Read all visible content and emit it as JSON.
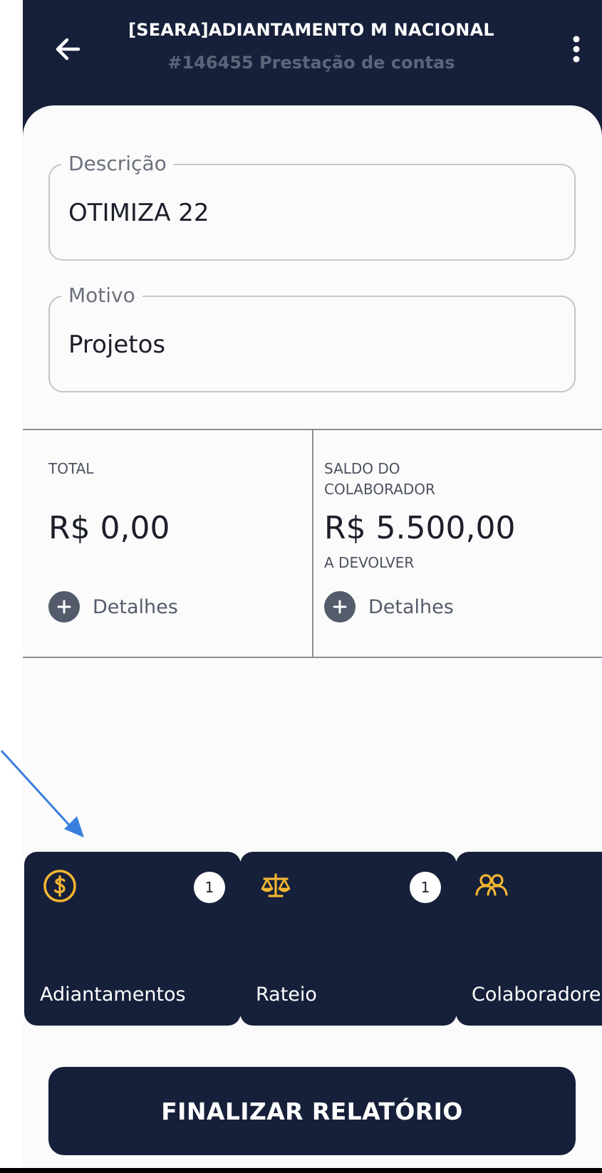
{
  "header": {
    "title": "[SEARA]ADIANTAMENTO M NACIONAL",
    "subtitle": "#146455 Prestação de contas",
    "back_icon": "arrow-left-icon",
    "menu_icon": "more-vertical-icon"
  },
  "form": {
    "description": {
      "label": "Descrição",
      "value": "OTIMIZA 22"
    },
    "reason": {
      "label": "Motivo",
      "value": "Projetos"
    }
  },
  "summary": {
    "total": {
      "label": "TOTAL",
      "value": "R$ 0,00",
      "details_label": "Detalhes"
    },
    "balance": {
      "label": "SALDO DO COLABORADOR",
      "value": "R$ 5.500,00",
      "sub_label": "A DEVOLVER",
      "details_label": "Detalhes"
    }
  },
  "cards": [
    {
      "label": "Adiantamentos",
      "badge": "1",
      "icon": "dollar-coin-icon"
    },
    {
      "label": "Rateio",
      "badge": "1",
      "icon": "scale-icon"
    },
    {
      "label": "Colaboradores",
      "badge": "",
      "icon": "users-icon"
    }
  ],
  "actions": {
    "finalize_label": "FINALIZAR RELATÓRIO"
  },
  "colors": {
    "primary_dark": "#16203a",
    "accent_yellow": "#f2b631",
    "annotation_arrow": "#3a7fe0",
    "sheet_background": "#fbfbfb"
  }
}
